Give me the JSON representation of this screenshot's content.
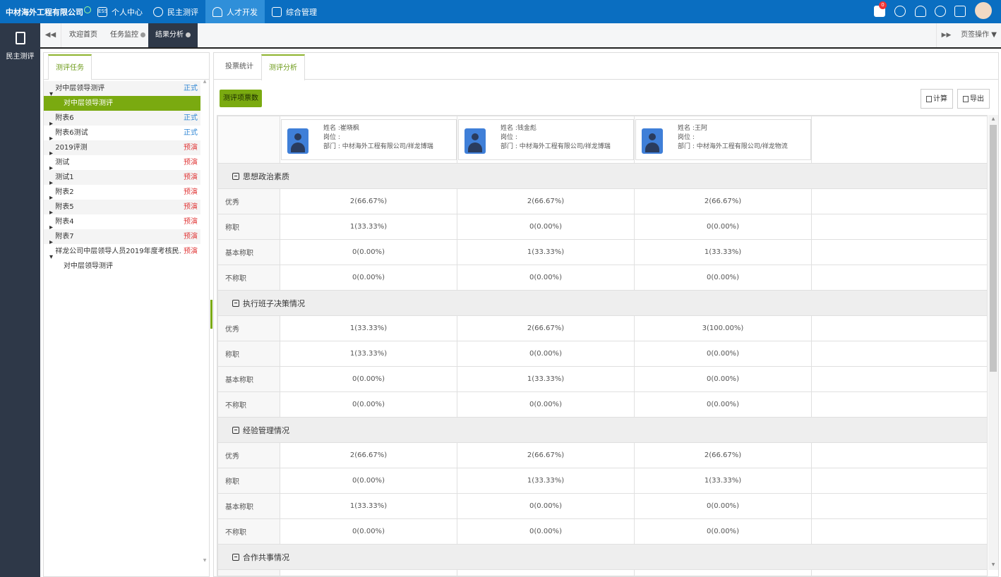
{
  "topbar": {
    "company": "中材海外工程有限公司",
    "nav": [
      {
        "label": "个人中心",
        "icon": "ess-icon"
      },
      {
        "label": "民主测评",
        "icon": "person-icon"
      },
      {
        "label": "人才开发",
        "icon": "people-icon",
        "active": true
      },
      {
        "label": "综合管理",
        "icon": "monitor-icon"
      }
    ],
    "message_count": "0"
  },
  "leftbar": {
    "item_label": "民主测评"
  },
  "tabs": {
    "items": [
      "欢迎首页",
      "任务监控",
      "结果分析"
    ],
    "page_ops": "页签操作"
  },
  "left_panel": {
    "tab": "测评任务",
    "tree": [
      {
        "label": "对中层领导测评",
        "status": "正式",
        "kind": "z",
        "expanded": true
      },
      {
        "label": "对中层领导测评",
        "status": "",
        "kind": "",
        "child": true,
        "selected": true
      },
      {
        "label": "附表6",
        "status": "正式",
        "kind": "z"
      },
      {
        "label": "附表6测试",
        "status": "正式",
        "kind": "z"
      },
      {
        "label": "2019评测",
        "status": "预演",
        "kind": "y"
      },
      {
        "label": "测试",
        "status": "预演",
        "kind": "y"
      },
      {
        "label": "测试1",
        "status": "预演",
        "kind": "y"
      },
      {
        "label": "附表2",
        "status": "预演",
        "kind": "y"
      },
      {
        "label": "附表5",
        "status": "预演",
        "kind": "y"
      },
      {
        "label": "附表4",
        "status": "预演",
        "kind": "y"
      },
      {
        "label": "附表7",
        "status": "预演",
        "kind": "y"
      },
      {
        "label": "祥龙公司中层领导人员2019年度考核民...",
        "status": "预演",
        "kind": "y",
        "expanded": true
      },
      {
        "label": "对中层领导测评",
        "status": "",
        "kind": "",
        "child": true
      }
    ]
  },
  "right_panel": {
    "tabs": [
      "投票统计",
      "测评分析"
    ],
    "active_tab": "测评分析",
    "count_button": "测评项票数",
    "calc_button": "计算",
    "export_button": "导出",
    "persons": [
      {
        "name": "姓名 :崔晓枫",
        "post": "岗位 :",
        "dept": "部门 : 中材海外工程有限公司/祥龙博瑞"
      },
      {
        "name": "姓名 :钱金彪",
        "post": "岗位 :",
        "dept": "部门 : 中材海外工程有限公司/祥龙博瑞"
      },
      {
        "name": "姓名 :王阿",
        "post": "岗位 :",
        "dept": "部门 : 中材海外工程有限公司/祥龙物流"
      }
    ],
    "sections": [
      {
        "title": "思想政治素质",
        "rows": [
          {
            "label": "优秀",
            "values": [
              "2(66.67%)",
              "2(66.67%)",
              "2(66.67%)"
            ]
          },
          {
            "label": "称职",
            "values": [
              "1(33.33%)",
              "0(0.00%)",
              "0(0.00%)"
            ]
          },
          {
            "label": "基本称职",
            "values": [
              "0(0.00%)",
              "1(33.33%)",
              "1(33.33%)"
            ]
          },
          {
            "label": "不称职",
            "values": [
              "0(0.00%)",
              "0(0.00%)",
              "0(0.00%)"
            ]
          }
        ]
      },
      {
        "title": "执行班子决策情况",
        "rows": [
          {
            "label": "优秀",
            "values": [
              "1(33.33%)",
              "2(66.67%)",
              "3(100.00%)"
            ]
          },
          {
            "label": "称职",
            "values": [
              "1(33.33%)",
              "0(0.00%)",
              "0(0.00%)"
            ]
          },
          {
            "label": "基本称职",
            "values": [
              "0(0.00%)",
              "1(33.33%)",
              "0(0.00%)"
            ]
          },
          {
            "label": "不称职",
            "values": [
              "0(0.00%)",
              "0(0.00%)",
              "0(0.00%)"
            ]
          }
        ]
      },
      {
        "title": "经验管理情况",
        "rows": [
          {
            "label": "优秀",
            "values": [
              "2(66.67%)",
              "2(66.67%)",
              "2(66.67%)"
            ]
          },
          {
            "label": "称职",
            "values": [
              "0(0.00%)",
              "1(33.33%)",
              "1(33.33%)"
            ]
          },
          {
            "label": "基本称职",
            "values": [
              "1(33.33%)",
              "0(0.00%)",
              "0(0.00%)"
            ]
          },
          {
            "label": "不称职",
            "values": [
              "0(0.00%)",
              "0(0.00%)",
              "0(0.00%)"
            ]
          }
        ]
      },
      {
        "title": "合作共事情况",
        "rows": [
          {
            "label": "",
            "values": [
              "",
              "",
              ""
            ]
          }
        ]
      }
    ]
  },
  "colors": {
    "topbar": "#0a6ec1",
    "accent_green": "#7aaa10",
    "sidebar": "#2e3848",
    "status_formal": "#2f86d4",
    "status_preview": "#e03a3a"
  }
}
